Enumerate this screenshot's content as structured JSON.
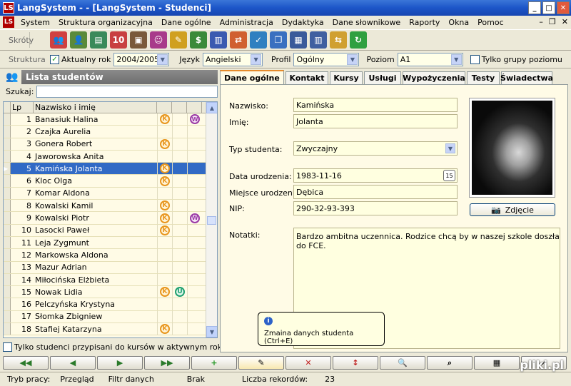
{
  "window": {
    "title": "LangSystem - - [LangSystem - Studenci]",
    "logo": "LS"
  },
  "menu": [
    "System",
    "Struktura organizacyjna",
    "Dane ogólne",
    "Administracja",
    "Dydaktyka",
    "Dane słownikowe",
    "Raporty",
    "Okna",
    "Pomoc"
  ],
  "toolbar": {
    "shortcuts_label": "Skróty",
    "structure_label": "Struktura",
    "current_year_label": "Aktualny rok",
    "current_year_value": "2004/2005",
    "language_label": "Język",
    "language_value": "Angielski",
    "profile_label": "Profil",
    "profile_value": "Ogólny",
    "level_label": "Poziom",
    "level_value": "A1",
    "only_level_groups_label": "Tylko grupy poziomu"
  },
  "student_list": {
    "title": "Lista studentów",
    "search_label": "Szukaj:",
    "col_lp": "Lp",
    "col_name": "Nazwisko i imię",
    "rows": [
      {
        "lp": "1",
        "name": "Banasiuk Halina",
        "k": true,
        "u": false,
        "w": true
      },
      {
        "lp": "2",
        "name": "Czajka Aurelia",
        "k": false,
        "u": false,
        "w": false
      },
      {
        "lp": "3",
        "name": "Gonera Robert",
        "k": true,
        "u": false,
        "w": false
      },
      {
        "lp": "4",
        "name": "Jaworowska Anita",
        "k": false,
        "u": false,
        "w": false
      },
      {
        "lp": "5",
        "name": "Kamińska Jolanta",
        "k": true,
        "u": false,
        "w": false,
        "selected": true
      },
      {
        "lp": "6",
        "name": "Kloc Olga",
        "k": true,
        "u": false,
        "w": false
      },
      {
        "lp": "7",
        "name": "Komar Aldona",
        "k": false,
        "u": false,
        "w": false
      },
      {
        "lp": "8",
        "name": "Kowalski Kamil",
        "k": true,
        "u": false,
        "w": false
      },
      {
        "lp": "9",
        "name": "Kowalski Piotr",
        "k": true,
        "u": false,
        "w": true
      },
      {
        "lp": "10",
        "name": "Lasocki Paweł",
        "k": true,
        "u": false,
        "w": false
      },
      {
        "lp": "11",
        "name": "Leja Zygmunt",
        "k": false,
        "u": false,
        "w": false
      },
      {
        "lp": "12",
        "name": "Markowska Aldona",
        "k": false,
        "u": false,
        "w": false
      },
      {
        "lp": "13",
        "name": "Mazur Adrian",
        "k": false,
        "u": false,
        "w": false
      },
      {
        "lp": "14",
        "name": "Miłocińska Elżbieta",
        "k": false,
        "u": false,
        "w": false
      },
      {
        "lp": "15",
        "name": "Nowak Lidia",
        "k": true,
        "u": true,
        "w": false
      },
      {
        "lp": "16",
        "name": "Pelczyńska Krystyna",
        "k": false,
        "u": false,
        "w": false
      },
      {
        "lp": "17",
        "name": "Słomka Zbigniew",
        "k": false,
        "u": false,
        "w": false
      },
      {
        "lp": "18",
        "name": "Stafiej Katarzyna",
        "k": true,
        "u": false,
        "w": false
      }
    ],
    "filter_label": "Tylko studenci przypisani do kursów w aktywnym roku"
  },
  "tabs": [
    "Dane ogólne",
    "Kontakt",
    "Kursy",
    "Usługi",
    "Wypożyczenia",
    "Testy",
    "Świadectwa"
  ],
  "form": {
    "surname_label": "Nazwisko:",
    "surname_value": "Kamińska",
    "firstname_label": "Imię:",
    "firstname_value": "Jolanta",
    "type_label": "Typ studenta:",
    "type_value": "Zwyczajny",
    "birthdate_label": "Data urodzenia:",
    "birthdate_value": "1983-11-16",
    "birthplace_label": "Miejsce urodzenia:",
    "birthplace_value": "Dębica",
    "nip_label": "NIP:",
    "nip_value": "290-32-93-393",
    "notes_label": "Notatki:",
    "notes_value": "Bardzo ambitna uczennica. Rodzice chcą by w naszej szkole doszła do FCE.",
    "photo_button": "Zdjęcie",
    "calendar_day": "15"
  },
  "tooltip": "Zmaina danych studenta (Ctrl+E)",
  "nav_buttons": [
    "◀◀",
    "◀",
    "▶",
    "▶▶",
    "+",
    "✎",
    "✕",
    "↕",
    "🔍",
    "⌕",
    "▦",
    "✓"
  ],
  "status": {
    "mode_label": "Tryb pracy:",
    "mode_value": "Przegląd",
    "filter_label": "Filtr danych",
    "filter_value": "Brak",
    "records_label": "Liczba rekordów:",
    "records_value": "23"
  },
  "watermark": "pliki.pl"
}
